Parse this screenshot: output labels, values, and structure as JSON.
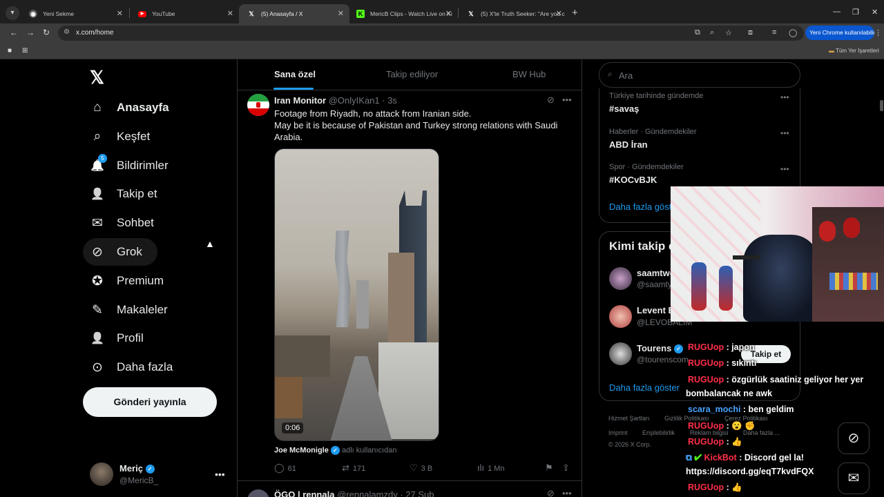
{
  "browser": {
    "tabs": [
      {
        "title": "Yeni Sekme",
        "active": false
      },
      {
        "title": "YouTube",
        "active": false
      },
      {
        "title": "(5) Anasayfa / X",
        "active": true
      },
      {
        "title": "MericB Clips - Watch Live on Ki",
        "active": false
      },
      {
        "title": "(5) X'te Truth Seeker: \"Are you c",
        "active": false
      }
    ],
    "url": "x.com/home",
    "update_label": "Yeni Chrome kullanılabilir",
    "all_bookmarks": "Tüm Yer İşaretleri",
    "accent": "#0b57d0"
  },
  "nav": {
    "items": [
      {
        "label": "Anasayfa",
        "icon": "home-icon",
        "glyph": "⌂"
      },
      {
        "label": "Keşfet",
        "icon": "search-icon",
        "glyph": "⌕"
      },
      {
        "label": "Bildirimler",
        "icon": "bell-icon",
        "glyph": "🔔",
        "badge": "5"
      },
      {
        "label": "Takip et",
        "icon": "follow-icon",
        "glyph": "👤"
      },
      {
        "label": "Sohbet",
        "icon": "chat-icon",
        "glyph": "✉"
      },
      {
        "label": "Grok",
        "icon": "grok-icon",
        "glyph": "⊘"
      },
      {
        "label": "Premium",
        "icon": "premium-icon",
        "glyph": "✪"
      },
      {
        "label": "Makaleler",
        "icon": "articles-icon",
        "glyph": "✎"
      },
      {
        "label": "Profil",
        "icon": "profile-icon",
        "glyph": "👤"
      },
      {
        "label": "Daha fazla",
        "icon": "more-icon",
        "glyph": "⊙"
      }
    ],
    "post_button": "Gönderi yayınla",
    "account": {
      "name": "Meriç",
      "handle": "@MericB_"
    }
  },
  "feed": {
    "tabs": [
      "Sana özel",
      "Takip ediliyor",
      "BW Hub"
    ],
    "tweet": {
      "name": "Iran Monitor",
      "handle": "@OnlyIKan1",
      "time": "· 3s",
      "line1": "Footage from Riyadh, no attack from Iranian side.",
      "line2": "May be it is because of Pakistan and Turkey strong relations with Saudi Arabia.",
      "duration": "0:06",
      "credit_name": "Joe McMonigle",
      "credit_sub": "adlı kullanıcıdan",
      "replies": "61",
      "reposts": "171",
      "likes": "3 B",
      "views": "1 Mn"
    },
    "next_tweet": {
      "name": "ÖGO | rennala",
      "handle": "@rennalamzdy · 27 Şub"
    }
  },
  "search": {
    "placeholder": "Ara"
  },
  "trends": [
    {
      "category": "Türkiye tarihinde gündemde",
      "name": "#savaş"
    },
    {
      "category": "Haberler · Gündemdekiler",
      "name": "ABD İran"
    },
    {
      "category": "Spor · Gündemdekiler",
      "name": "#KOCvBJK"
    }
  ],
  "trends_show_more": "Daha fazla göster",
  "who_to_follow": {
    "title": "Kimi takip e",
    "users": [
      {
        "name": "saamtwo",
        "handle": "@saamty"
      },
      {
        "name": "Levent B",
        "handle": "@LEVOBALIM"
      },
      {
        "name": "Tourens",
        "handle": "@tourenscom"
      }
    ],
    "follow_label": "Takip et",
    "show_more": "Daha fazla göster"
  },
  "footer": {
    "links": [
      "Hizmet Şartları",
      "Gizlilik Politikası",
      "Çerez Politikası",
      "Imprint",
      "Erişilebilirlik",
      "Reklam bilgisi",
      "Daha fazla ..."
    ],
    "copyright": "© 2026 X Corp."
  },
  "chat": [
    {
      "user": "RUGUop",
      "text": ": japon",
      "color": "red"
    },
    {
      "user": "RUGUop",
      "text": ": sıkıntı",
      "color": "red"
    },
    {
      "user": "RUGUop",
      "text": ": özgürlük saatiniz geliyor her yer",
      "color": "red"
    },
    {
      "user": "",
      "text": "bombalancak ne awk",
      "color": "red"
    },
    {
      "user": "scara_mochi",
      "text": ": ben geldim",
      "color": "blue"
    },
    {
      "user": "RUGUop",
      "text": ": 😮 ✊",
      "color": "red"
    },
    {
      "user": "RUGUop",
      "text": ": 👍",
      "color": "red"
    },
    {
      "user": "KickBot",
      "text": ": Discord gel la!",
      "color": "red"
    },
    {
      "user": "",
      "text": "https://discord.gg/eqT7kvdFQX",
      "color": "red"
    },
    {
      "user": "RUGUop",
      "text": ": 👍",
      "color": "red"
    }
  ]
}
